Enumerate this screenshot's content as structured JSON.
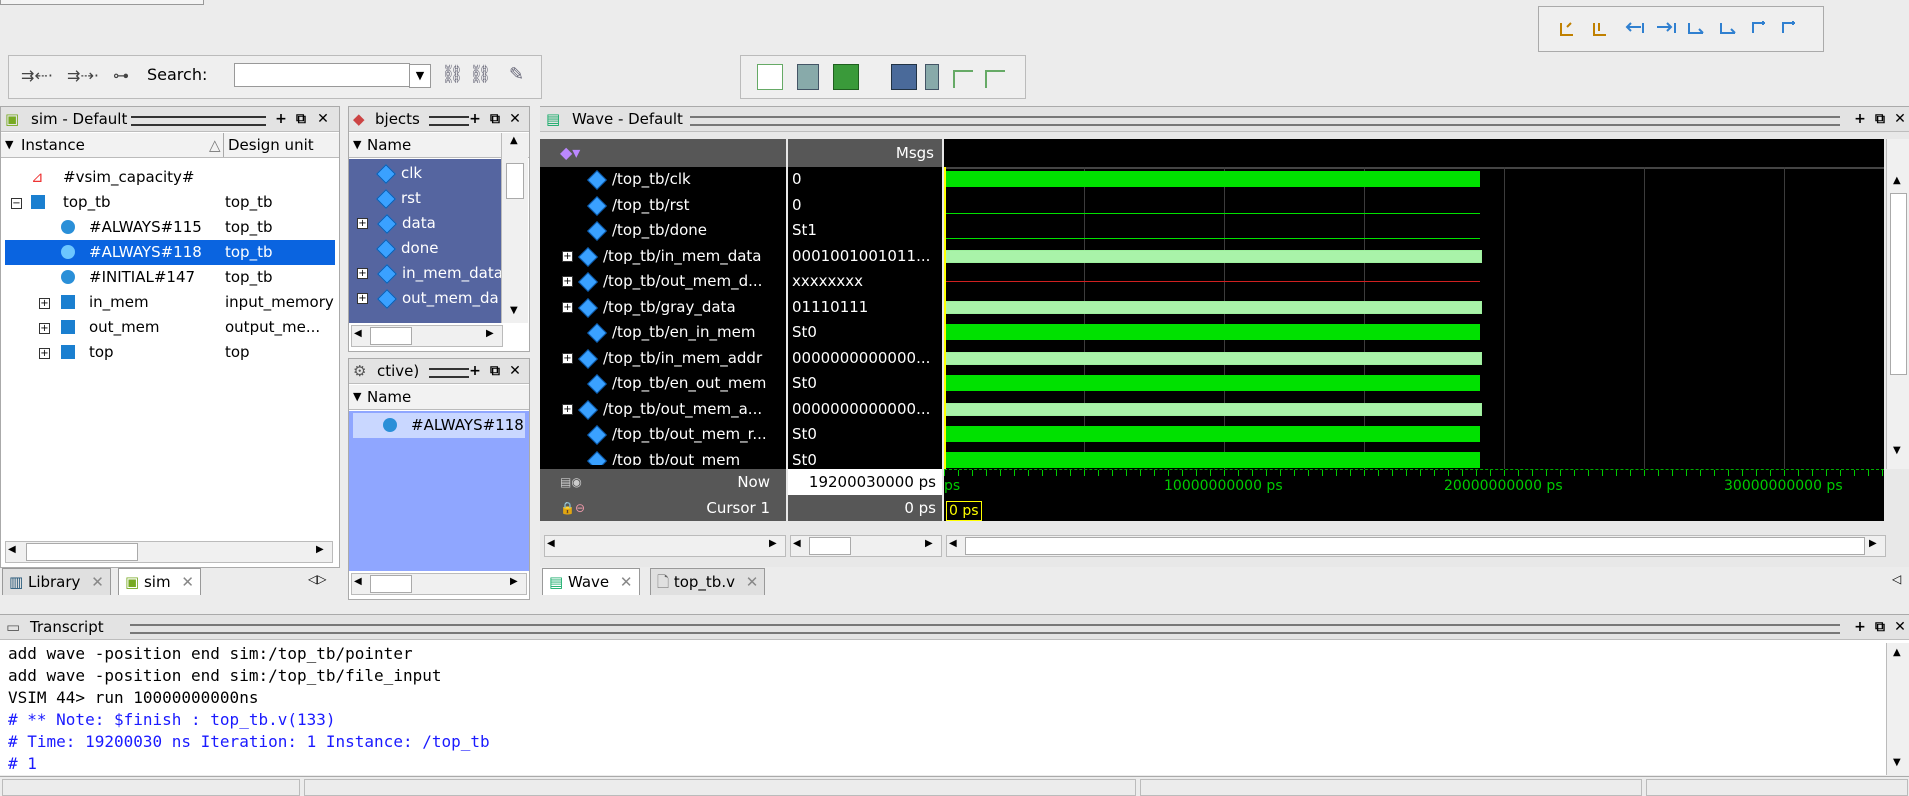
{
  "toolbar": {
    "search_label": "Search:",
    "search_value": ""
  },
  "sim_panel": {
    "title": "sim - Default",
    "col_instance": "Instance",
    "col_design_unit": "Design unit",
    "rows": [
      {
        "name": "#vsim_capacity#",
        "unit": ""
      },
      {
        "name": "top_tb",
        "unit": "top_tb"
      },
      {
        "name": "#ALWAYS#115",
        "unit": "top_tb"
      },
      {
        "name": "#ALWAYS#118",
        "unit": "top_tb"
      },
      {
        "name": "#INITIAL#147",
        "unit": "top_tb"
      },
      {
        "name": "in_mem",
        "unit": "input_memory"
      },
      {
        "name": "out_mem",
        "unit": "output_me..."
      },
      {
        "name": "top",
        "unit": "top"
      }
    ],
    "tab_library": "Library",
    "tab_sim": "sim"
  },
  "objects_panel": {
    "title": "bjects",
    "col_name": "Name",
    "items": [
      "clk",
      "rst",
      "data",
      "done",
      "in_mem_data",
      "out_mem_da"
    ]
  },
  "processes_panel": {
    "title": "ctive)",
    "col_name": "Name",
    "items": [
      "#ALWAYS#118"
    ]
  },
  "wave_panel": {
    "title": "Wave - Default",
    "msgs_label": "Msgs",
    "signals": [
      {
        "name": "/top_tb/clk",
        "value": "0",
        "bus": false
      },
      {
        "name": "/top_tb/rst",
        "value": "0",
        "bus": false
      },
      {
        "name": "/top_tb/done",
        "value": "St1",
        "bus": false
      },
      {
        "name": "/top_tb/in_mem_data",
        "value": "0001001001011...",
        "bus": true
      },
      {
        "name": "/top_tb/out_mem_d...",
        "value": "xxxxxxxx",
        "bus": true
      },
      {
        "name": "/top_tb/gray_data",
        "value": "01110111",
        "bus": true
      },
      {
        "name": "/top_tb/en_in_mem",
        "value": "St0",
        "bus": false
      },
      {
        "name": "/top_tb/in_mem_addr",
        "value": "0000000000000...",
        "bus": true
      },
      {
        "name": "/top_tb/en_out_mem",
        "value": "St0",
        "bus": false
      },
      {
        "name": "/top_tb/out_mem_a...",
        "value": "0000000000000...",
        "bus": true
      },
      {
        "name": "/top_tb/out_mem_r...",
        "value": "St0",
        "bus": false
      },
      {
        "name": "/top_tb/out_mem",
        "value": "St0",
        "bus": false
      }
    ],
    "now_label": "Now",
    "now_value": "19200030000 ps",
    "cursor_label": "Cursor 1",
    "cursor_value": "0 ps",
    "cursor_marker": "0 ps",
    "ticks": [
      "ps",
      "10000000000 ps",
      "20000000000 ps",
      "30000000000 ps"
    ],
    "tab_wave": "Wave",
    "tab_file": "top_tb.v"
  },
  "transcript": {
    "title": "Transcript",
    "lines": [
      {
        "text": "add wave -position end  sim:/top_tb/pointer",
        "color": "#000000"
      },
      {
        "text": "add wave -position end  sim:/top_tb/file_input",
        "color": "#000000"
      },
      {
        "text": "VSIM 44> run 10000000000ns",
        "color": "#000000"
      },
      {
        "text": "# ** Note: $finish    : top_tb.v(133)",
        "color": "#1a1aff"
      },
      {
        "text": "#    Time: 19200030 ns  Iteration: 1  Instance: /top_tb",
        "color": "#1a1aff"
      },
      {
        "text": "# 1",
        "color": "#1a1aff"
      }
    ]
  }
}
